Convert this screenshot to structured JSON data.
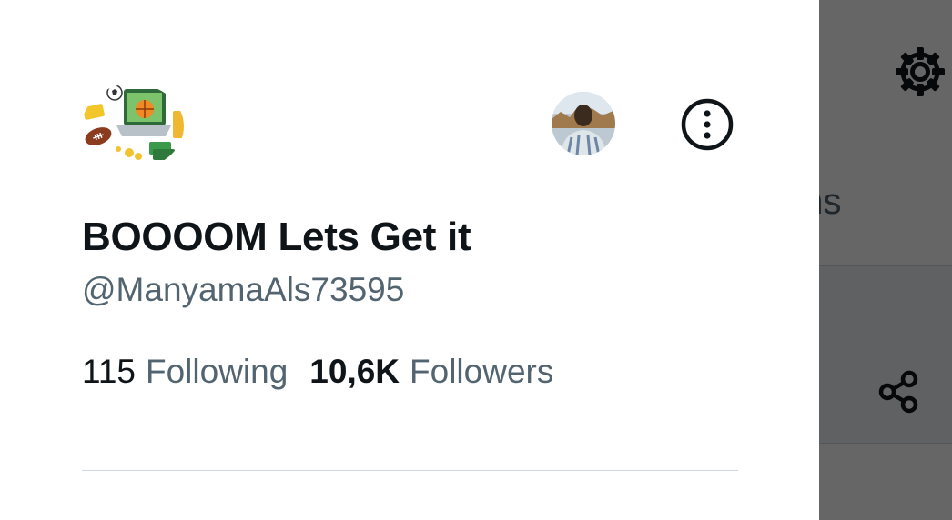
{
  "background": {
    "tab_label_partial": "tions"
  },
  "drawer": {
    "display_name": "BOOOOM Lets Get it",
    "handle": "@ManyamaAls73595",
    "following": {
      "count": "115",
      "label": "Following"
    },
    "followers": {
      "count": "10,6K",
      "label": "Followers"
    }
  },
  "icons": {
    "settings": "gear-icon",
    "share": "share-icon",
    "more": "more-options-icon"
  },
  "colors": {
    "text_primary": "#0f1419",
    "text_secondary": "#536471",
    "divider": "#cfd9de",
    "scrim": "rgba(0,0,0,0.6)"
  }
}
